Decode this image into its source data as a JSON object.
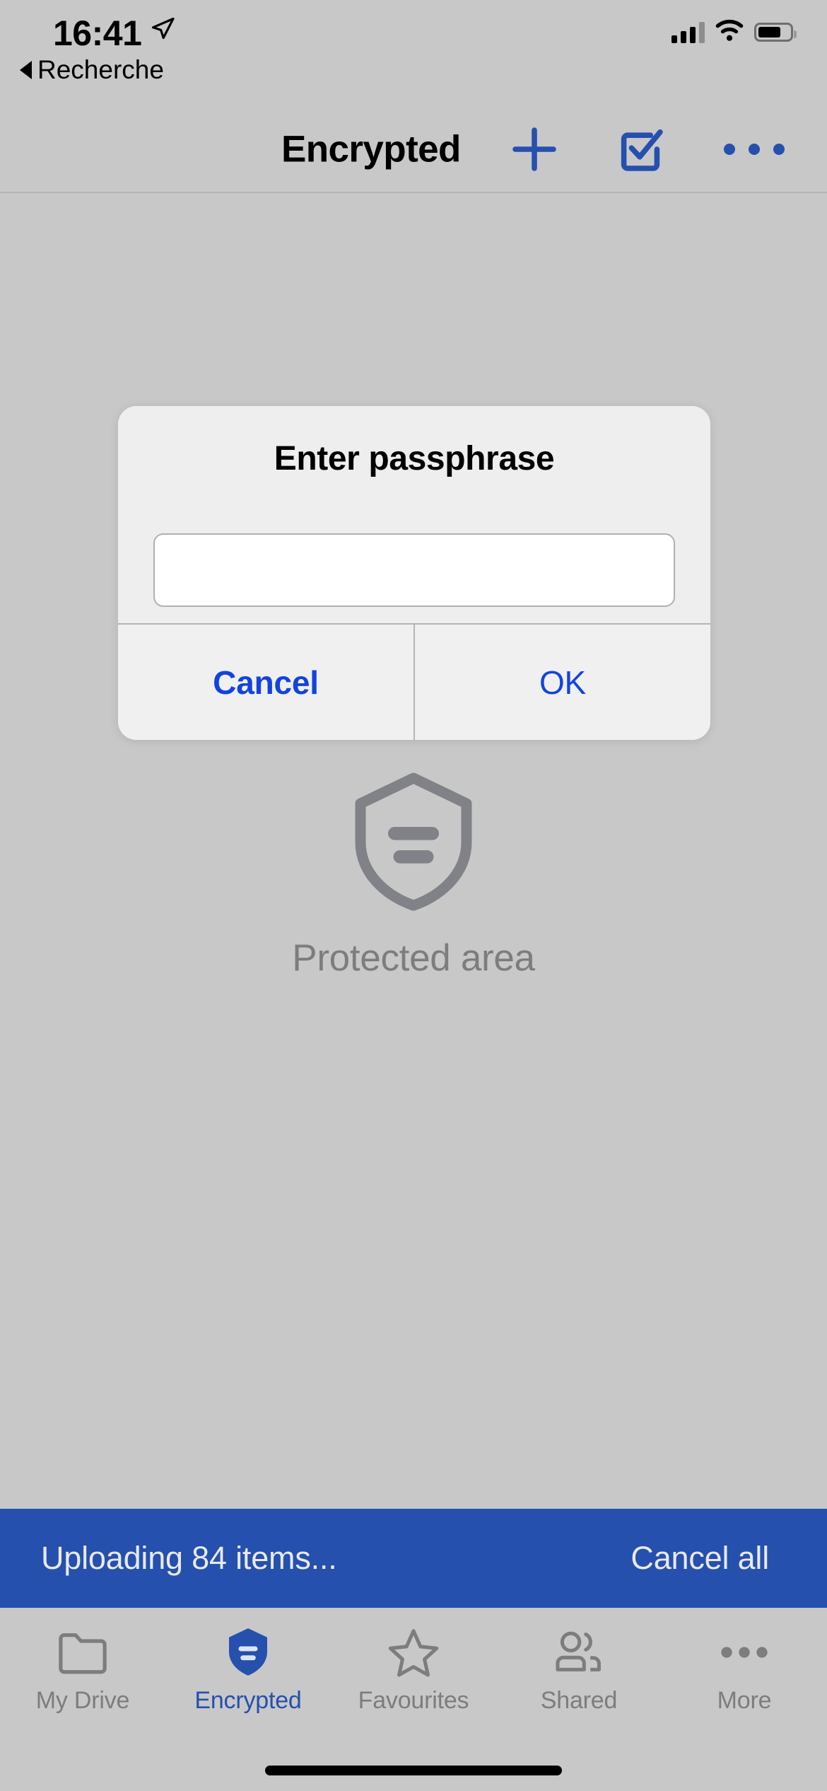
{
  "status_bar": {
    "time": "16:41",
    "location_icon": "location-arrow-icon",
    "cellular_icon": "cellular-signal-icon",
    "wifi_icon": "wifi-icon",
    "battery_icon": "battery-icon",
    "battery_level_percent": 64
  },
  "back_link": {
    "label": "Recherche",
    "icon": "back-caret-icon"
  },
  "nav_bar": {
    "title": "Encrypted",
    "add_icon": "plus-icon",
    "select_icon": "checkbox-edit-icon",
    "more_icon": "ellipsis-icon",
    "accent_color": "#2550ae"
  },
  "dialog": {
    "title": "Enter passphrase",
    "input": {
      "value": "",
      "placeholder": ""
    },
    "cancel_label": "Cancel",
    "ok_label": "OK",
    "button_color": "#1243e0",
    "background_color": "#eeeeee"
  },
  "empty_state": {
    "icon": "shield-lines-icon",
    "label": "Protected area",
    "color": "#7d7d7d"
  },
  "upload_banner": {
    "status_text": "Uploading 84 items...",
    "cancel_label": "Cancel all",
    "item_count": 84,
    "background_color": "#2550ae",
    "text_color": "#e9e9ec"
  },
  "tab_bar": {
    "active_index": 1,
    "active_color": "#2550ae",
    "inactive_color": "#7d7d7d",
    "tabs": [
      {
        "label": "My Drive",
        "icon": "folder-icon"
      },
      {
        "label": "Encrypted",
        "icon": "shield-filled-icon"
      },
      {
        "label": "Favourites",
        "icon": "star-outline-icon"
      },
      {
        "label": "Shared",
        "icon": "people-icon"
      },
      {
        "label": "More",
        "icon": "ellipsis-icon"
      }
    ]
  },
  "home_indicator": {
    "name": "home-indicator"
  }
}
